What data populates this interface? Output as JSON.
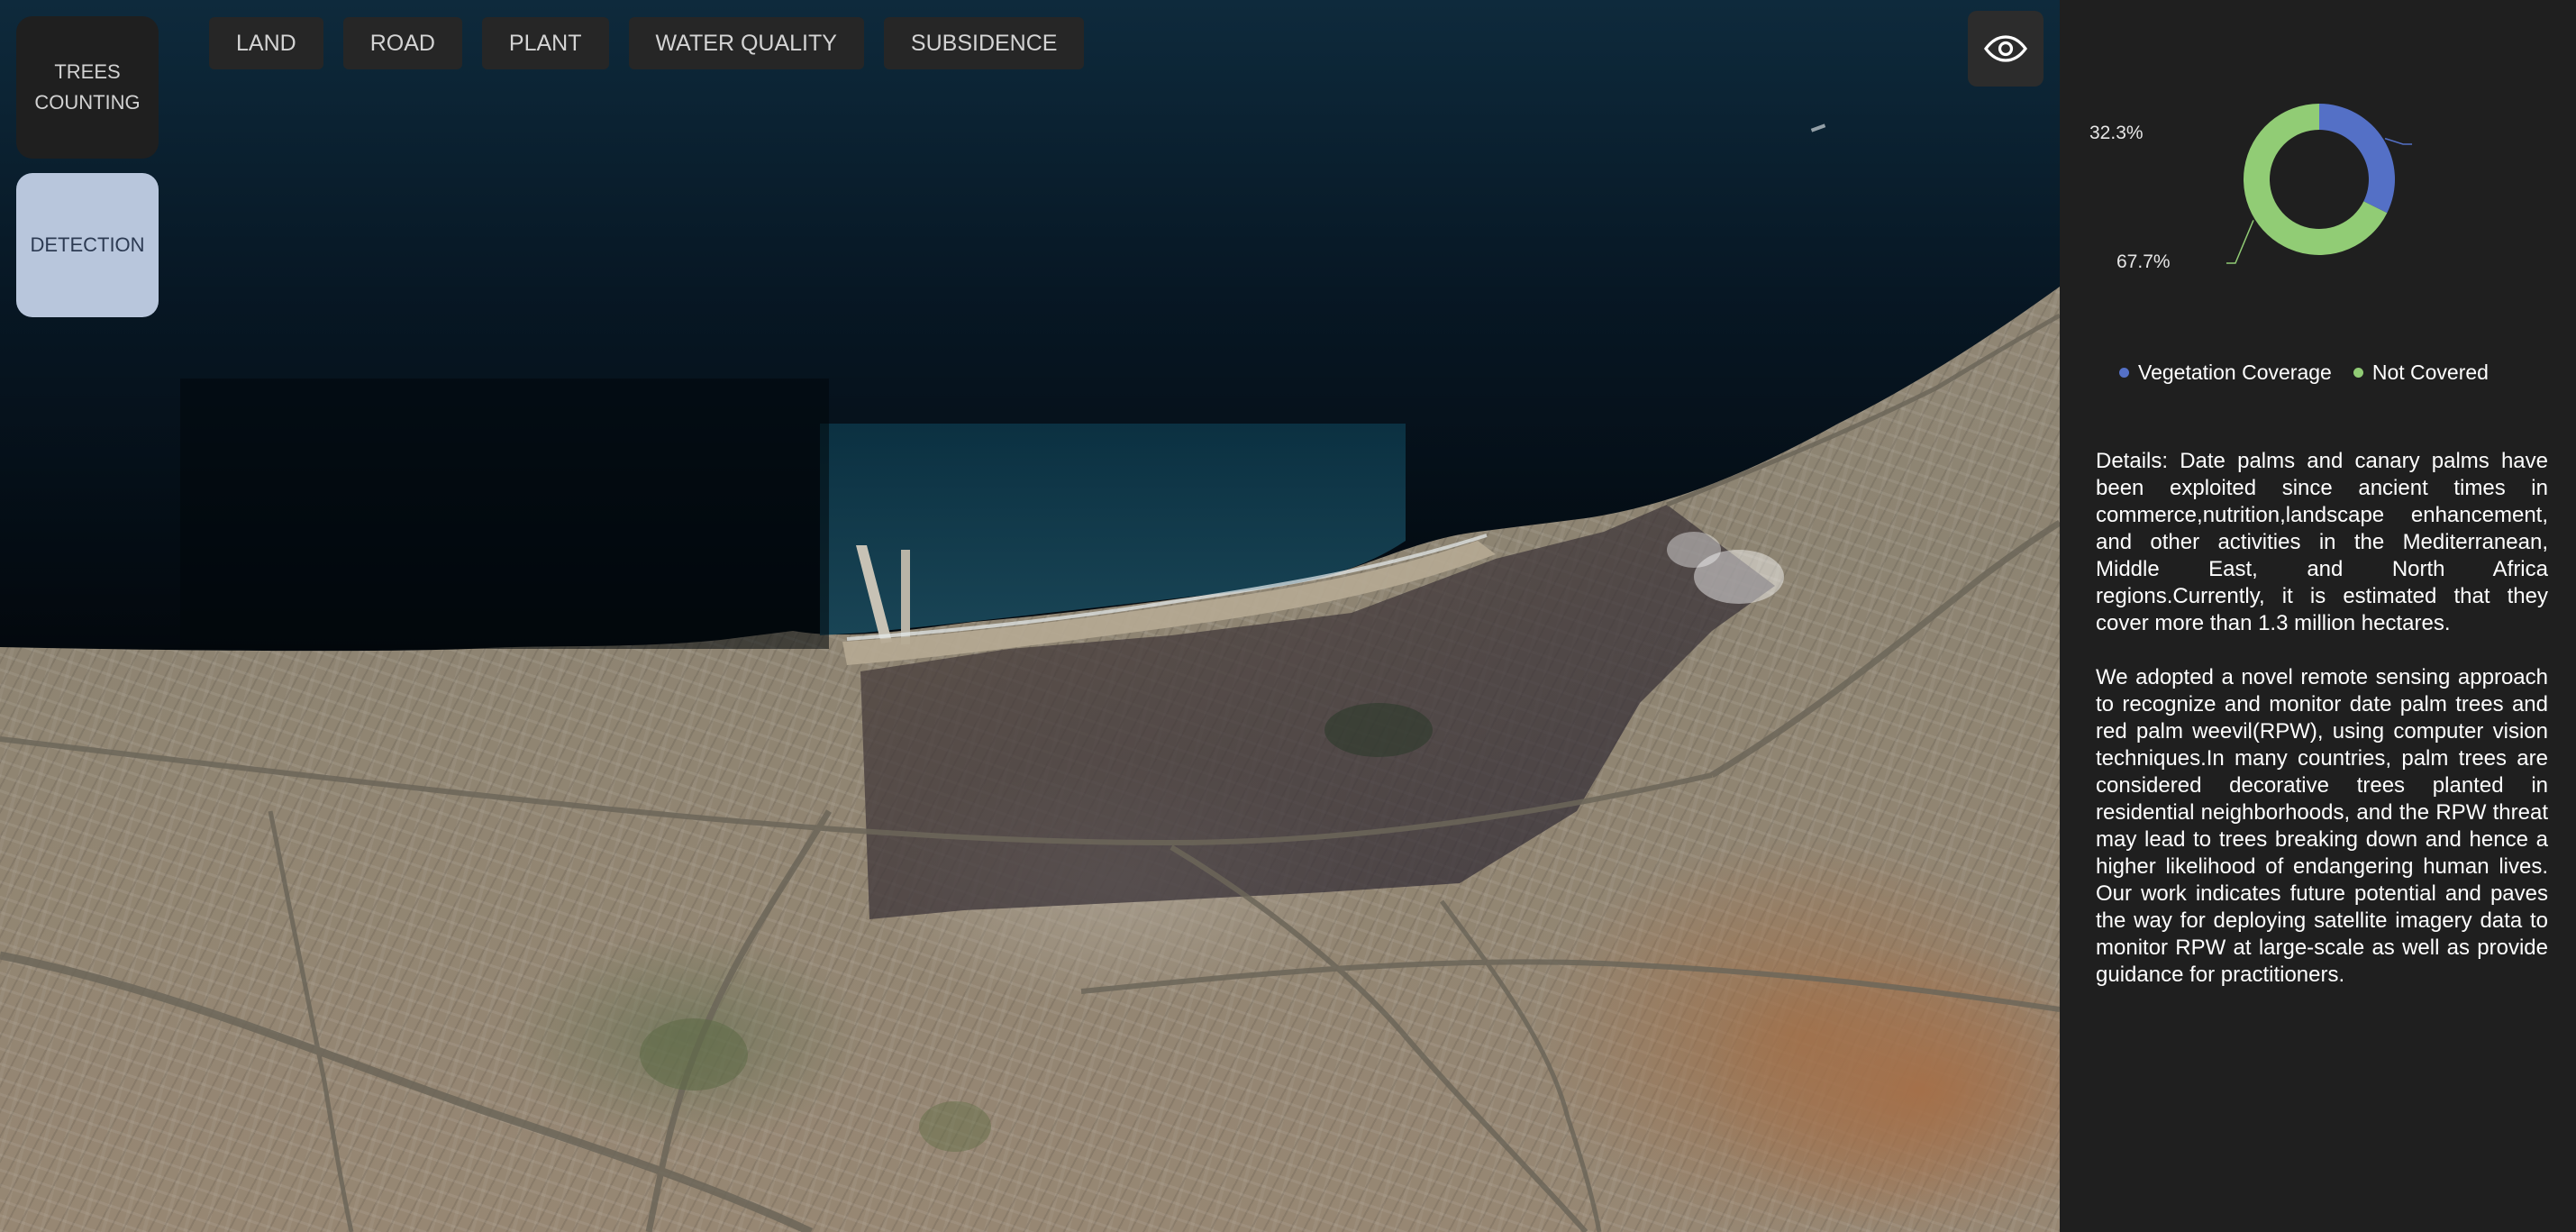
{
  "mode_buttons": {
    "trees_counting": "TREES\nCOUNTING",
    "detection": "DETECTION"
  },
  "tabs": [
    {
      "label": "LAND"
    },
    {
      "label": "ROAD"
    },
    {
      "label": "PLANT"
    },
    {
      "label": "WATER QUALITY"
    },
    {
      "label": "SUBSIDENCE"
    }
  ],
  "toolbar": {
    "visibility_icon": "eye-icon"
  },
  "chart_data": {
    "type": "pie",
    "donut": true,
    "categories": [
      "Vegetation Coverage",
      "Not Covered"
    ],
    "values": [
      32.3,
      67.7
    ],
    "data_labels": [
      "32.3%",
      "67.7%"
    ],
    "colors": [
      "#5470c6",
      "#91cc75"
    ],
    "legend_position": "bottom"
  },
  "panel": {
    "legend": [
      {
        "label": "Vegetation Coverage",
        "color": "#5470c6"
      },
      {
        "label": "Not Covered",
        "color": "#91cc75"
      }
    ],
    "details_p1": "Details: Date palms and canary palms have been exploited since ancient times in commerce,nutrition,landscape enhancement, and other activities in the Mediterranean, Middle East, and North Africa regions.Currently, it is estimated that they cover more than 1.3 million hectares.",
    "details_p2": "We adopted a novel remote sensing approach to recognize and monitor date palm trees and red palm weevil(RPW), using computer vision techniques.In many countries, palm trees are considered decorative trees planted in residential neighborhoods, and the RPW threat may lead to trees breaking down and hence a higher likelihood of endangering human lives. Our work indicates future potential and paves the way for deploying satellite imagery data to monitor RPW at large-scale as well as provide guidance for practitioners."
  }
}
